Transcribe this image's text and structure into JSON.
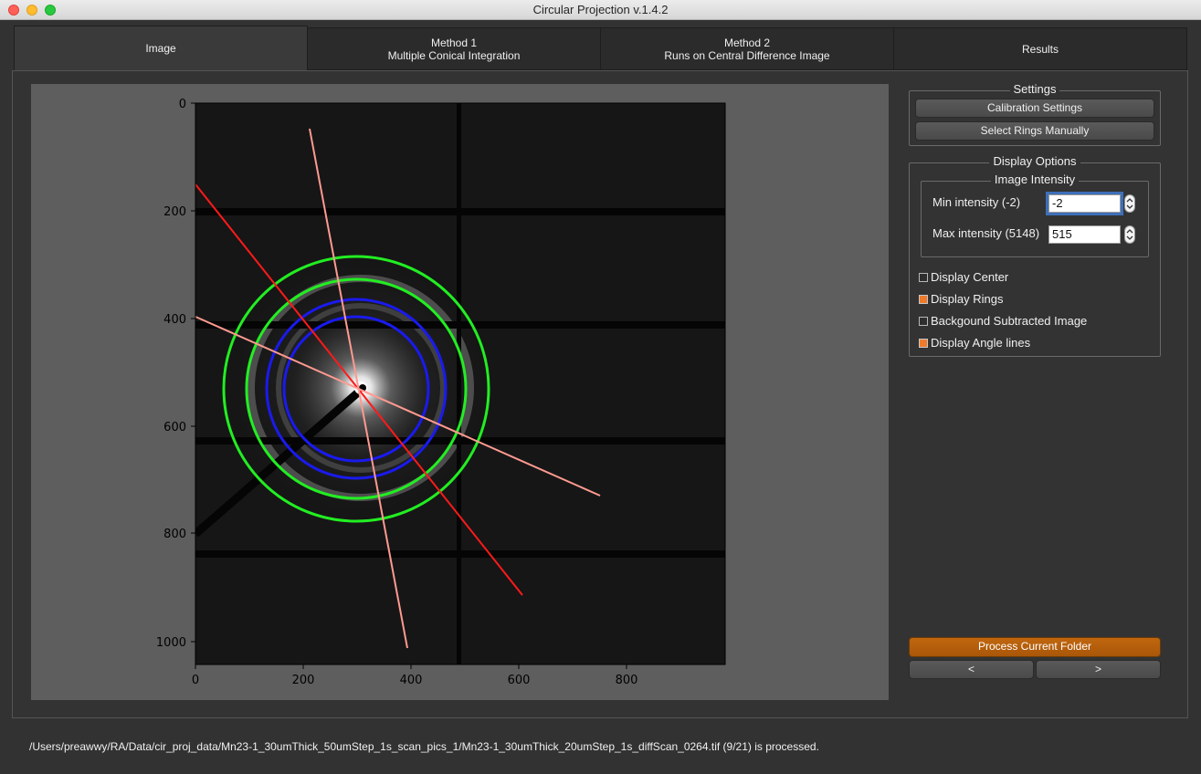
{
  "window": {
    "title": "Circular Projection v.1.4.2"
  },
  "tabs": [
    {
      "line1": "Image",
      "line2": ""
    },
    {
      "line1": "Method 1",
      "line2": "Multiple Conical Integration"
    },
    {
      "line1": "Method 2",
      "line2": "Runs on Central Difference Image"
    },
    {
      "line1": "Results",
      "line2": ""
    }
  ],
  "active_tab": "Image",
  "plot": {
    "x_ticks": [
      "0",
      "200",
      "400",
      "600",
      "800"
    ],
    "y_ticks": [
      "0",
      "200",
      "400",
      "600",
      "800",
      "1000"
    ],
    "colors": {
      "outer_rings": "#22ee22",
      "inner_rings": "#1a1aee",
      "angle_line_1": "#ff1a1a",
      "angle_line_2": "#ff9a90"
    }
  },
  "settings": {
    "title": "Settings",
    "calibration_button": "Calibration Settings",
    "select_rings_button": "Select Rings Manually"
  },
  "display_options": {
    "title": "Display Options",
    "image_intensity_title": "Image Intensity",
    "min_label": "Min intensity (-2)",
    "min_value": "-2",
    "max_label": "Max intensity (5148)",
    "max_value": "515",
    "checkboxes": [
      {
        "label": "Display Center",
        "checked": false
      },
      {
        "label": "Display Rings",
        "checked": true
      },
      {
        "label": "Backgound Subtracted Image",
        "checked": false
      },
      {
        "label": "Display Angle lines",
        "checked": true
      }
    ]
  },
  "actions": {
    "process_button": "Process Current Folder",
    "prev_button": "<",
    "next_button": ">"
  },
  "status": "/Users/preawwy/RA/Data/cir_proj_data/Mn23-1_30umThick_50umStep_1s_scan_pics_1/Mn23-1_30umThick_20umStep_1s_diffScan_0264.tif (9/21) is processed.",
  "accent_color": "#b8600c"
}
